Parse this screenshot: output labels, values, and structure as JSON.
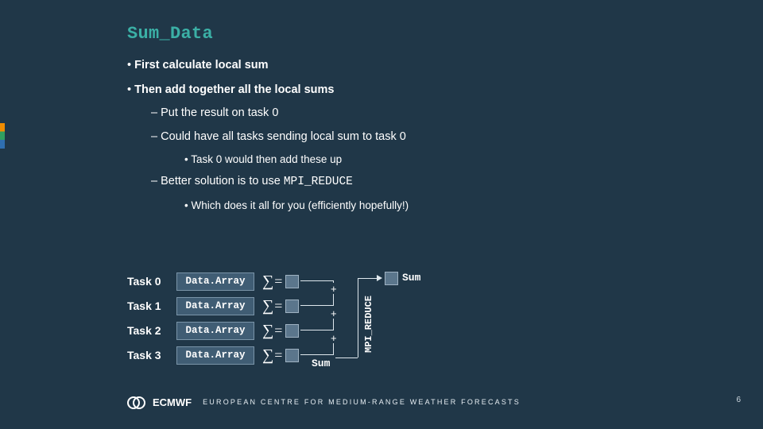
{
  "title": "Sum_Data",
  "bullets": {
    "p1": "First calculate local sum",
    "p2": "Then add together all the local sums",
    "s1": "Put the result on task 0",
    "s2": "Could have all tasks sending local sum to task 0",
    "t1": "Task 0 would then add these up",
    "s3_prefix": "Better solution is to use ",
    "s3_code": "MPI_REDUCE",
    "t2": "Which does it all for you (efficiently hopefully!)"
  },
  "tasks": [
    {
      "label": "Task 0",
      "pill": "Data.Array"
    },
    {
      "label": "Task 1",
      "pill": "Data.Array"
    },
    {
      "label": "Task 2",
      "pill": "Data.Array"
    },
    {
      "label": "Task 3",
      "pill": "Data.Array"
    }
  ],
  "sigma": "∑",
  "eq": "=",
  "plus": "+",
  "sum_label_left": "Sum",
  "mpi_label": "MPI_REDUCE",
  "sum_label_right": "Sum",
  "footer": {
    "org": "ECMWF",
    "tag": "EUROPEAN CENTRE FOR MEDIUM-RANGE WEATHER FORECASTS",
    "page": "6"
  }
}
